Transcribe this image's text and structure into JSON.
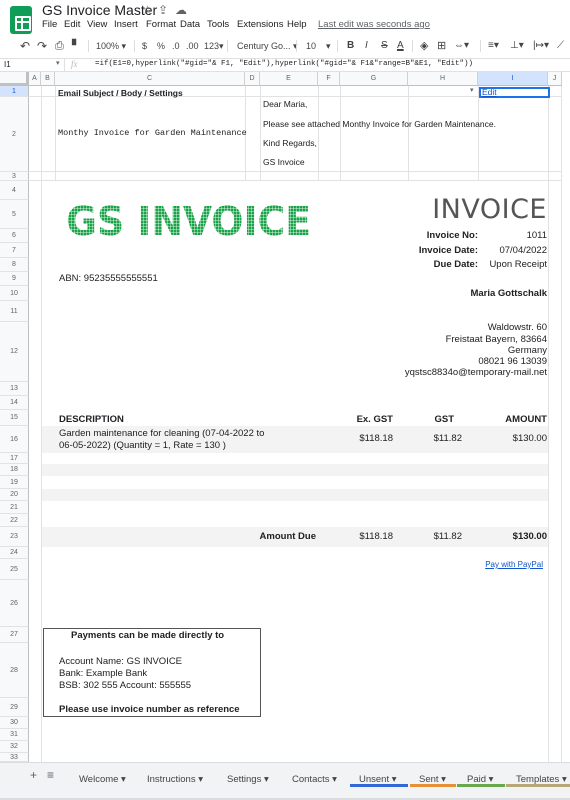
{
  "app": {
    "title": "GS Invoice Master",
    "menu": [
      "File",
      "Edit",
      "View",
      "Insert",
      "Format",
      "Data",
      "Tools",
      "Extensions",
      "Help"
    ],
    "last_edit": "Last edit was seconds ago"
  },
  "toolbar": {
    "zoom": "100%",
    "currency": "$",
    "percent": "%",
    "dec_decrease": ".0",
    "dec_increase": ".00",
    "more_formats": "123",
    "font": "Century Go...",
    "font_size": "10",
    "bold": "B",
    "italic": "I",
    "strike": "S",
    "text_color": "A"
  },
  "formula": {
    "cell": "I1",
    "fx": "fx",
    "value": "=if(E1=0,hyperlink(\"#gid=\"& F1, \"Edit\"),hyperlink(\"#gid=\"& F1&\"range=B\"&E1, \"Edit\"))"
  },
  "columns": [
    "A",
    "B",
    "C",
    "D",
    "E",
    "F",
    "G",
    "H",
    "I",
    "J"
  ],
  "rows": [
    "1",
    "2",
    "3",
    "4",
    "5",
    "6",
    "7",
    "8",
    "9",
    "10",
    "11",
    "12",
    "13",
    "14",
    "15",
    "16",
    "17",
    "18",
    "19",
    "20",
    "21",
    "22",
    "23",
    "24",
    "25",
    "26",
    "27",
    "28",
    "29",
    "30",
    "31",
    "32",
    "33"
  ],
  "email": {
    "header": "Email Subject / Body / Settings",
    "subject": "Monthy Invoice for Garden Maintenance",
    "greeting": "Dear Maria,",
    "body": "Please see attached Monthy Invoice for Garden Maintenance.",
    "closing": "Kind Regards,",
    "signature": "GS Invoice",
    "edit_cell": "Edit"
  },
  "invoice": {
    "logo_text": "GS INVOICE",
    "heading": "INVOICE",
    "number_label": "Invoice No:",
    "number": "1011",
    "date_label": "Invoice Date:",
    "date": "07/04/2022",
    "due_label": "Due Date:",
    "due": "Upon Receipt",
    "abn": "ABN: 95235555555551"
  },
  "client": {
    "name": "Maria Gottschalk",
    "street": "Waldowstr. 60",
    "city": "Freistaat Bayern, 83664",
    "country": "Germany",
    "phone": "08021 96 13039",
    "email": "yqstsc8834o@temporary-mail.net"
  },
  "table": {
    "headers": [
      "DESCRIPTION",
      "Ex. GST",
      "GST",
      "AMOUNT"
    ],
    "item_line1": "Garden maintenance for cleaning (07-04-2022 to",
    "item_line2": "06-05-2022) (Quantity = 1, Rate = 130 )",
    "ex_gst": "$118.18",
    "gst": "$11.82",
    "amount": "$130.00",
    "total_label": "Amount Due",
    "total_ex": "$118.18",
    "total_gst": "$11.82",
    "total_amount": "$130.00"
  },
  "paypal": "Pay with PayPal",
  "payment": {
    "title": "Payments can be made directly to",
    "account_name": "Account Name: GS INVOICE",
    "bank": "Bank: Example Bank",
    "bsb": "BSB: 302 555 Account: 555555",
    "note": "Please use invoice number as reference"
  },
  "tabs": [
    "Welcome",
    "Instructions",
    "Settings",
    "Contacts",
    "Unsent",
    "Sent",
    "Paid",
    "Templates"
  ],
  "colors": {
    "logo_green": "#19a347",
    "unsent": "#3367d6",
    "sent": "#e69138",
    "paid": "#6aa84f",
    "templates": "#b7a87a"
  }
}
